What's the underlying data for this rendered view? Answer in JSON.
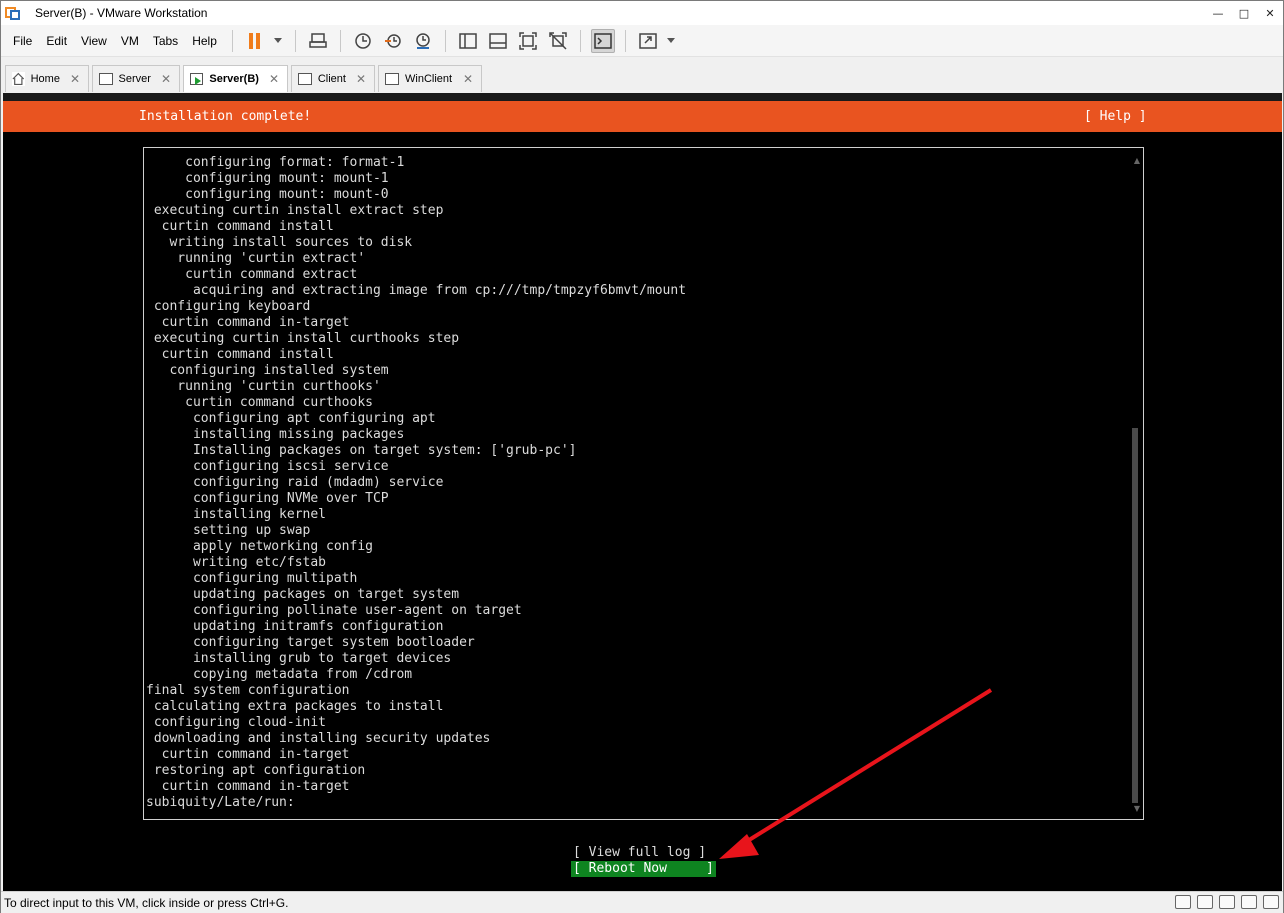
{
  "window": {
    "title": "Server(B) - VMware Workstation",
    "controls": {
      "minimize": "—",
      "maximize": "□",
      "close": "✕"
    }
  },
  "menu": {
    "items": [
      "File",
      "Edit",
      "View",
      "VM",
      "Tabs",
      "Help"
    ]
  },
  "toolbar": {
    "icons": [
      "pause-icon",
      "send-ctrl-alt-del-icon",
      "snapshot-icon",
      "revert-snapshot-icon",
      "snapshot-manager-icon",
      "show-library-icon",
      "thumbnail-bar-icon",
      "full-screen-icon",
      "unity-icon",
      "console-view-icon",
      "stretch-guest-icon"
    ]
  },
  "tabs": [
    {
      "label": "Home",
      "active": false
    },
    {
      "label": "Server",
      "active": false
    },
    {
      "label": "Server(B)",
      "active": true
    },
    {
      "label": "Client",
      "active": false
    },
    {
      "label": "WinClient",
      "active": false
    }
  ],
  "console": {
    "header_title": "Installation complete!",
    "header_help": "[ Help ]",
    "log_lines": [
      "     configuring format: format-1",
      "     configuring mount: mount-1",
      "     configuring mount: mount-0",
      " executing curtin install extract step",
      "  curtin command install",
      "   writing install sources to disk",
      "    running 'curtin extract'",
      "     curtin command extract",
      "      acquiring and extracting image from cp:///tmp/tmpzyf6bmvt/mount",
      " configuring keyboard",
      "  curtin command in-target",
      " executing curtin install curthooks step",
      "  curtin command install",
      "   configuring installed system",
      "    running 'curtin curthooks'",
      "     curtin command curthooks",
      "      configuring apt configuring apt",
      "      installing missing packages",
      "      Installing packages on target system: ['grub-pc']",
      "      configuring iscsi service",
      "      configuring raid (mdadm) service",
      "      configuring NVMe over TCP",
      "      installing kernel",
      "      setting up swap",
      "      apply networking config",
      "      writing etc/fstab",
      "      configuring multipath",
      "      updating packages on target system",
      "      configuring pollinate user-agent on target",
      "      updating initramfs configuration",
      "      configuring target system bootloader",
      "      installing grub to target devices",
      "      copying metadata from /cdrom",
      "final system configuration",
      " calculating extra packages to install",
      " configuring cloud-init",
      " downloading and installing security updates",
      "  curtin command in-target",
      " restoring apt configuration",
      "  curtin command in-target",
      "subiquity/Late/run:"
    ],
    "view_log_button": "[ View full log ]",
    "reboot_button": "[ Reboot Now     ]"
  },
  "status": {
    "text": "To direct input to this VM, click inside or press Ctrl+G."
  },
  "colors": {
    "ubuntu_orange": "#e95420",
    "reboot_green": "#0e8420",
    "arrow_red": "#e8141b",
    "pause_orange": "#f07c1b"
  }
}
